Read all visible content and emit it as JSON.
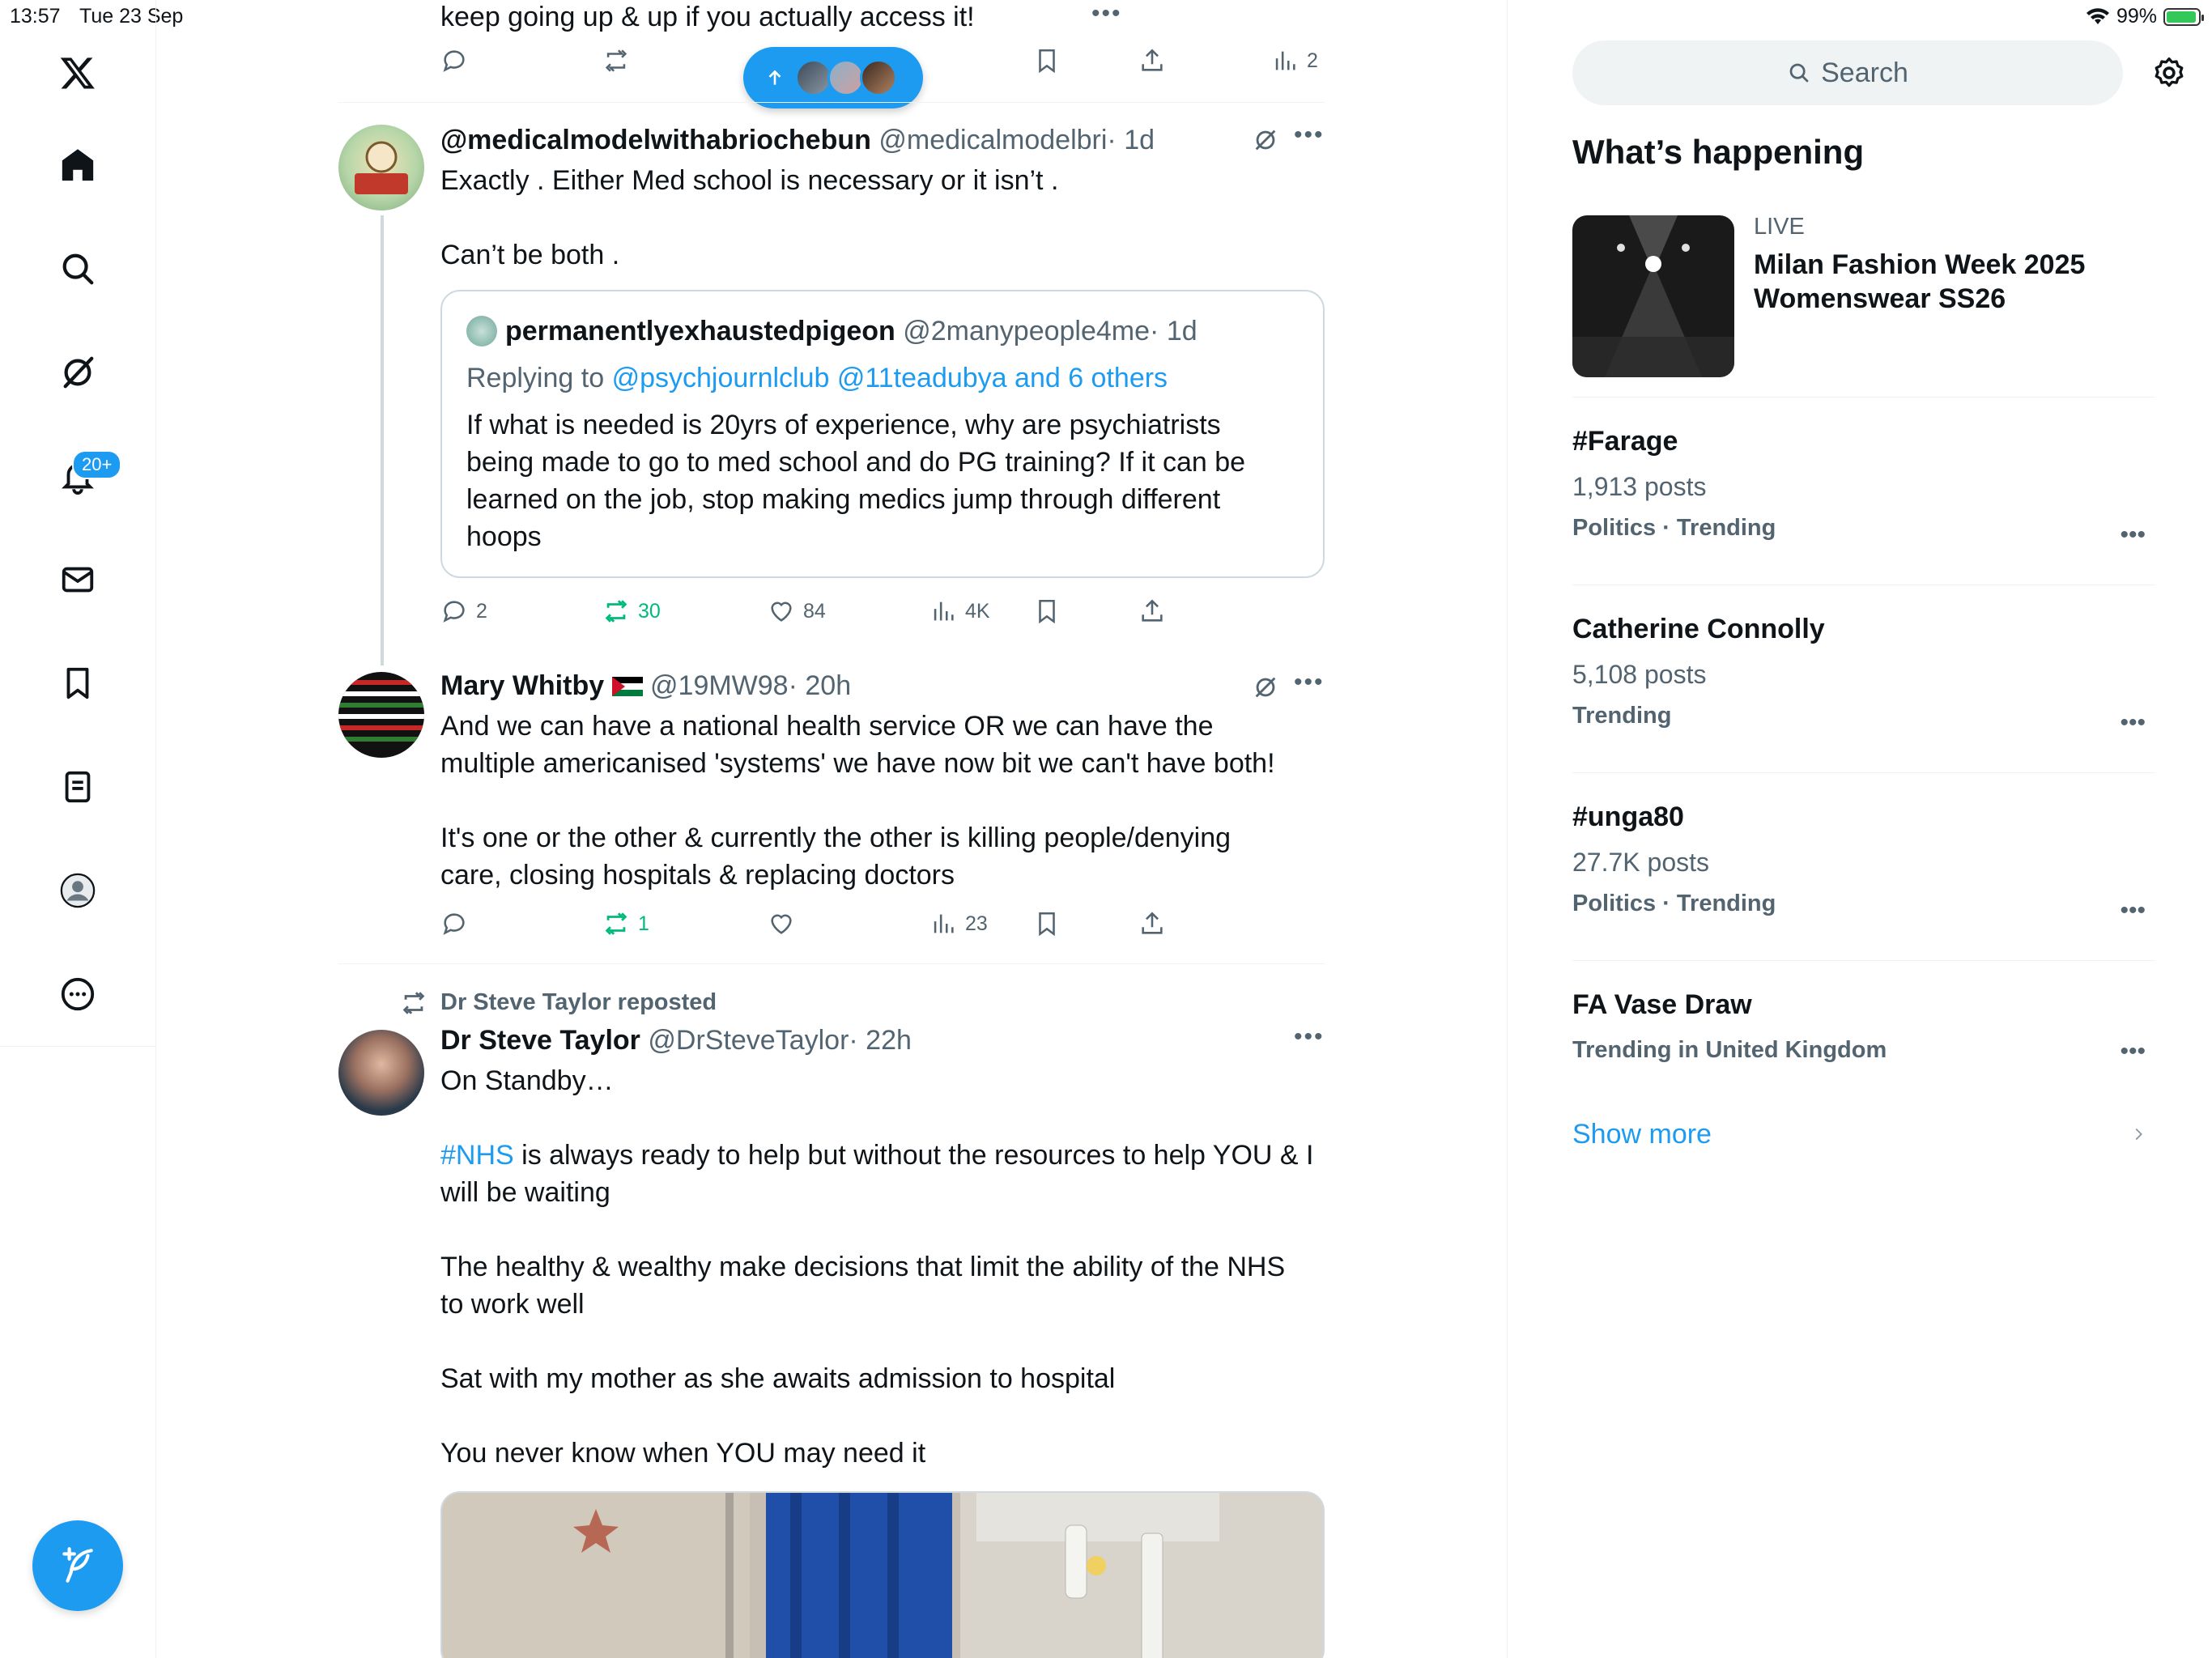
{
  "status_bar": {
    "time": "13:57",
    "date": "Tue 23 Sep",
    "battery": "99%"
  },
  "nav": {
    "badge": "20+"
  },
  "feed": {
    "top_post": {
      "text": "keep going up & up if you actually access it!",
      "views": "2",
      "more": "•••"
    },
    "post1": {
      "name": "@medicalmodelwithabriochebun",
      "handle": "@medicalmodelbri",
      "time": "· 1d",
      "line1": "Exactly . Either Med school is necessary or it isn’t .",
      "line2": "Can’t be both .",
      "quote": {
        "name": "permanentlyexhaustedpigeon",
        "handle": "@2manypeople4me",
        "time": "· 1d",
        "replying_prefix": "Replying to",
        "replying_to": "@psychjournlclub @11teadubya and 6 others",
        "line1": "If what is needed is 20yrs of experience, why are psychiatrists",
        "line2": "being made to go to med school and do PG training? If it can be",
        "line3": "learned on the job, stop making medics jump through different",
        "line4": "hoops"
      },
      "replies": "2",
      "reposts": "30",
      "likes": "84",
      "views": "4K"
    },
    "post2": {
      "name": "Mary Whitby",
      "handle": "@19MW98",
      "time": "· 20h",
      "line1": "And we can have a national health service OR we can have the",
      "line2": "multiple americanised 'systems' we have now bit we can't have both!",
      "line3": "It's one or the other & currently the other is killing people/denying",
      "line4": "care, closing hospitals & replacing doctors",
      "reposts": "1",
      "views": "23"
    },
    "post3": {
      "repost_label": "Dr Steve Taylor reposted",
      "name": "Dr Steve Taylor",
      "handle": "@DrSteveTaylor",
      "time": "· 22h",
      "line1": "On Standby…",
      "hashtag": "#NHS",
      "line2": " is always ready to help but without the resources to help YOU & I",
      "line3": "will be waiting",
      "line4": "The healthy & wealthy make decisions that limit the ability of the NHS",
      "line5": "to work well",
      "line6": "Sat with my mother as she awaits admission to hospital",
      "line7": "You never know when YOU may need it"
    }
  },
  "sidebar": {
    "search_placeholder": "Search",
    "title": "What’s happening",
    "live": {
      "label": "LIVE",
      "line1": "Milan Fashion Week 2025",
      "line2": "Womenswear SS26"
    },
    "trends": [
      {
        "name": "#Farage",
        "posts": "1,913 posts",
        "category": "Politics · Trending"
      },
      {
        "name": "Catherine Connolly",
        "posts": "5,108 posts",
        "category": "Trending"
      },
      {
        "name": "#unga80",
        "posts": "27.7K posts",
        "category": "Politics · Trending"
      },
      {
        "name": "FA Vase Draw",
        "category": "Trending in United Kingdom"
      }
    ],
    "show_more": "Show more"
  },
  "colors": {
    "accent": "#1d9bf0",
    "repost_green": "#00ba7c",
    "muted": "#536471"
  }
}
